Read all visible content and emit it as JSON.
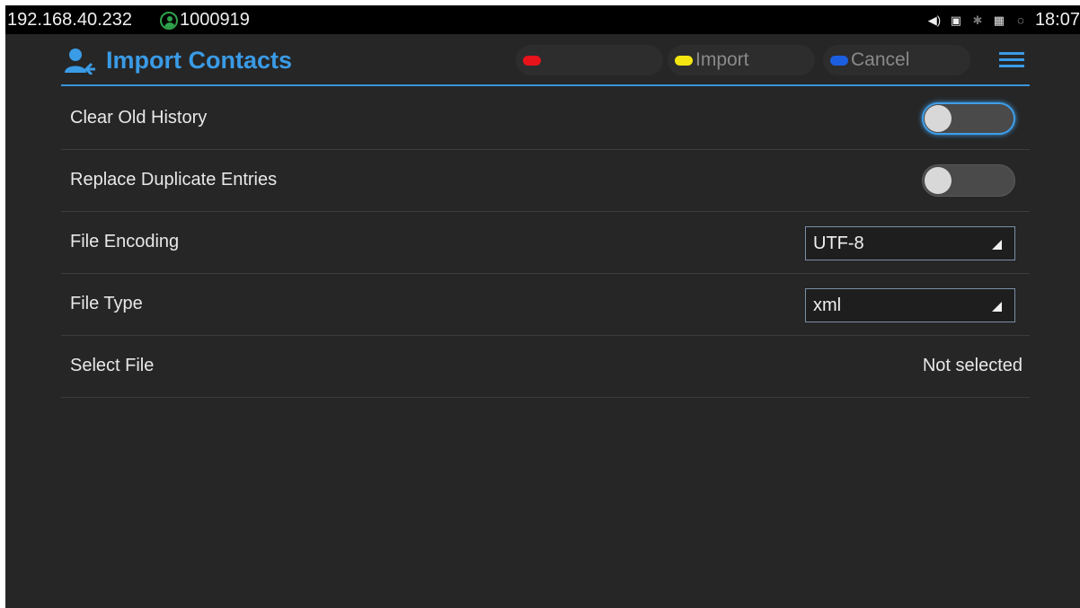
{
  "status_bar": {
    "ip": "192.168.40.232",
    "account": "1000919",
    "account_icon": "account-icon",
    "icons": [
      "volume-icon",
      "voicemail-icon",
      "bluetooth-icon",
      "sd-card-icon",
      "sync-icon"
    ],
    "time": "18:07"
  },
  "header": {
    "title": "Import Contacts",
    "title_icon": "import-contacts-icon",
    "softkeys": [
      {
        "label": "",
        "color": "#e8131b"
      },
      {
        "label": "Import",
        "color": "#f5e611"
      },
      {
        "label": "Cancel",
        "color": "#1b5fe0"
      }
    ],
    "menu_icon": "menu-icon"
  },
  "settings": {
    "clear_old_history": {
      "label": "Clear Old History",
      "enabled": false
    },
    "replace_duplicates": {
      "label": "Replace Duplicate Entries",
      "enabled": false
    },
    "file_encoding": {
      "label": "File Encoding",
      "value": "UTF-8"
    },
    "file_type": {
      "label": "File Type",
      "value": "xml"
    },
    "select_file": {
      "label": "Select File",
      "value": "Not selected"
    }
  },
  "colors": {
    "accent": "#3a9be6",
    "background": "#262626"
  }
}
